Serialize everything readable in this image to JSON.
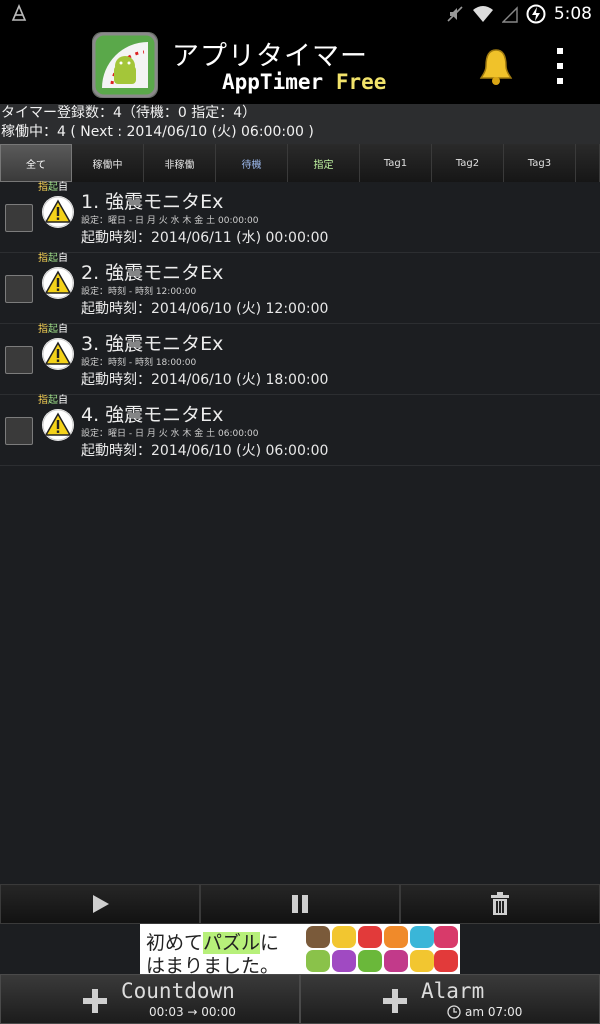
{
  "status_bar": {
    "time": "5:08"
  },
  "app": {
    "title_jp": "アプリタイマー",
    "title_en": "AppTimer",
    "title_free": "Free"
  },
  "summary": {
    "line1": "タイマー登録数：4（待機：0  指定：4）",
    "line2": "稼働中：4  ( Next : 2014/06/10 (火) 06:00:00 )"
  },
  "tabs": [
    "全て",
    "稼働中",
    "非稼働",
    "待機",
    "指定",
    "Tag1",
    "Tag2",
    "Tag3"
  ],
  "timers": [
    {
      "flag1": "指",
      "flag2": "起",
      "flag3": "自",
      "name": "1. 強震モニタEx",
      "setting": "設定：曜日 - 日 月 火 水 木 金 土  00:00:00",
      "next": "起動時刻：2014/06/11 (水) 00:00:00"
    },
    {
      "flag1": "指",
      "flag2": "起",
      "flag3": "自",
      "name": "2. 強震モニタEx",
      "setting": "設定：時刻 - 時刻  12:00:00",
      "next": "起動時刻：2014/06/10 (火) 12:00:00"
    },
    {
      "flag1": "指",
      "flag2": "起",
      "flag3": "自",
      "name": "3. 強震モニタEx",
      "setting": "設定：時刻 - 時刻  18:00:00",
      "next": "起動時刻：2014/06/10 (火) 18:00:00"
    },
    {
      "flag1": "指",
      "flag2": "起",
      "flag3": "自",
      "name": "4. 強震モニタEx",
      "setting": "設定：曜日 - 日 月 火 水 木 金 土  06:00:00",
      "next": "起動時刻：2014/06/10 (火) 06:00:00"
    }
  ],
  "ad": {
    "line1_a": "初めて",
    "line1_hl": "パズル",
    "line1_b": "に",
    "line2": "はまりました。"
  },
  "bottom": {
    "countdown_label": "Countdown",
    "countdown_sub": "00:03 → 00:00",
    "alarm_label": "Alarm",
    "alarm_sub": "am 07:00"
  },
  "colors": {
    "accent_yellow": "#f2e36a",
    "bg": "#1c1e21"
  }
}
